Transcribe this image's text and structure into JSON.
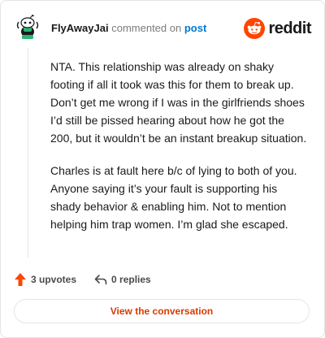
{
  "header": {
    "username": "FlyAwayJai",
    "commented_text": "commented on",
    "post_link_text": "post",
    "brand": "reddit",
    "avatar_icon": "snoo-avatar-icon"
  },
  "comment": {
    "paragraphs": [
      "NTA. This relationship was already on shaky footing if all it took was this for them to break up. Don’t get me wrong if I was in the girlfriends shoes I’d still be pissed hearing about how he got the 200, but it wouldn’t be an instant breakup situation.",
      "Charles is at fault here b/c of lying to both of you. Anyone saying it’s your fault is supporting his shady behavior & enabling him. Not to mention helping him trap women. I’m glad she escaped."
    ]
  },
  "actions": {
    "upvotes_label": "3 upvotes",
    "replies_label": "0 replies",
    "upvote_icon": "upvote-arrow-icon",
    "reply_icon": "reply-arrow-icon"
  },
  "footer": {
    "view_button_label": "View the conversation"
  },
  "colors": {
    "accent": "#ff4500",
    "link": "#0079d3",
    "button_text": "#d93a00",
    "border": "#e5e5e5"
  }
}
